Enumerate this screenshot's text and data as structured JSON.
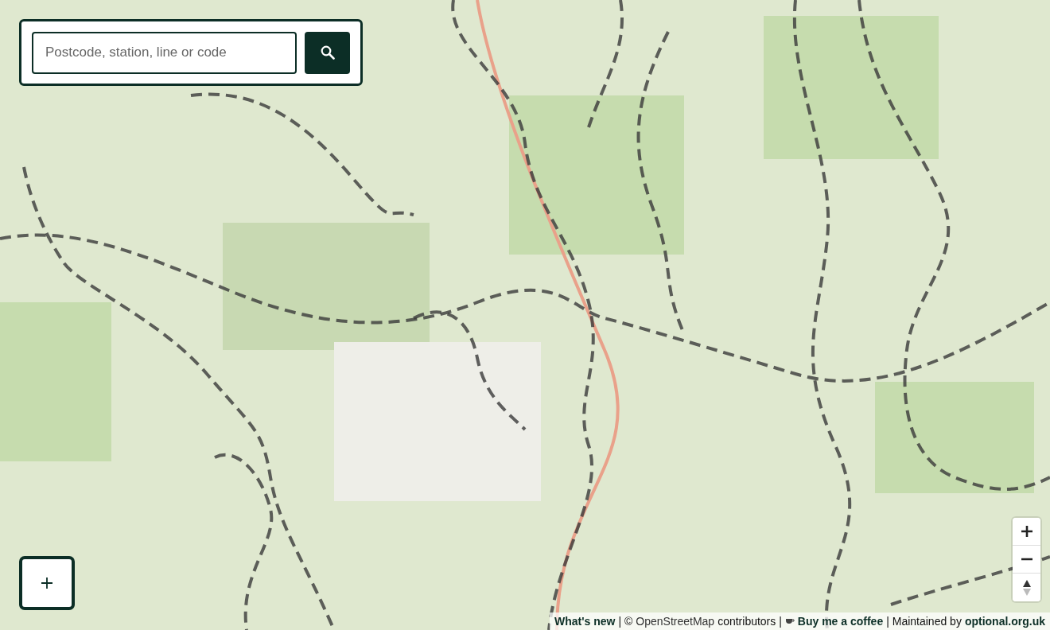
{
  "search": {
    "placeholder": "Postcode, station, line or code"
  },
  "attribution": [
    {
      "kind": "bold-link",
      "text": "What's new"
    },
    {
      "kind": "text",
      "text": "| ©"
    },
    {
      "kind": "plain-link",
      "text": "OpenStreetMap"
    },
    {
      "kind": "text",
      "text": "contributors |"
    },
    {
      "kind": "coffee-link",
      "text": "Buy me a coffee"
    },
    {
      "kind": "text",
      "text": "| Maintained by"
    },
    {
      "kind": "bold-link",
      "text": "optional.org.uk"
    }
  ]
}
